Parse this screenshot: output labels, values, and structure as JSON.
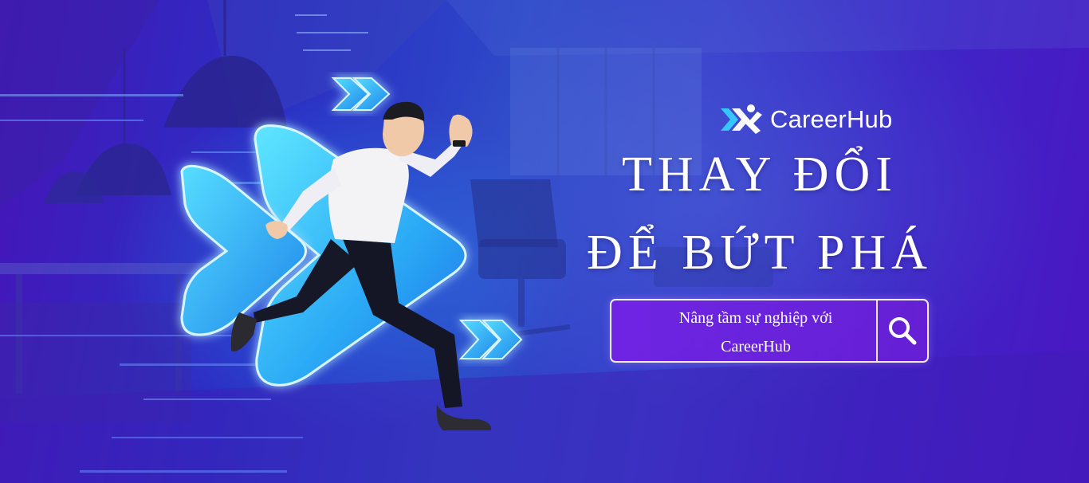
{
  "brand": {
    "name": "CareerHub",
    "logo_icon": "careerhub-logo-icon"
  },
  "headline": {
    "line1": "THAY ĐỔI",
    "line2": "ĐỂ BỨT PHÁ"
  },
  "search": {
    "text_line1": "Nâng tầm sự nghiệp với",
    "text_line2": "CareerHub",
    "icon": "search-icon"
  },
  "colors": {
    "background_start": "#4614b8",
    "background_mid": "#2d48c8",
    "background_end": "#4a16c2",
    "chevron_cyan": "#3fd4ff",
    "search_fill": "#7a1ee6",
    "text": "#ffffff"
  }
}
